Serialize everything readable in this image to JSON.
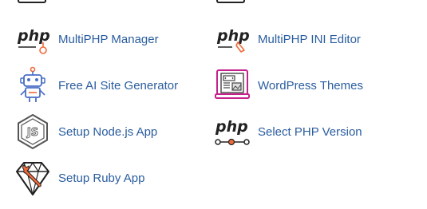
{
  "apps": {
    "multiphp_manager": "MultiPHP Manager",
    "multiphp_ini_editor": "MultiPHP INI Editor",
    "ai_site_generator": "Free AI Site Generator",
    "wordpress_themes": "WordPress Themes",
    "nodejs_app": "Setup Node.js App",
    "select_php_version": "Select PHP Version",
    "ruby_app": "Setup Ruby App"
  },
  "icons": {
    "php_text": "php",
    "nodejs_text": "JS"
  },
  "colors": {
    "link": "#2a5d9f",
    "accent_orange": "#f26a3a",
    "robot_blue": "#4a6fc7",
    "magenta": "#c5228c"
  }
}
